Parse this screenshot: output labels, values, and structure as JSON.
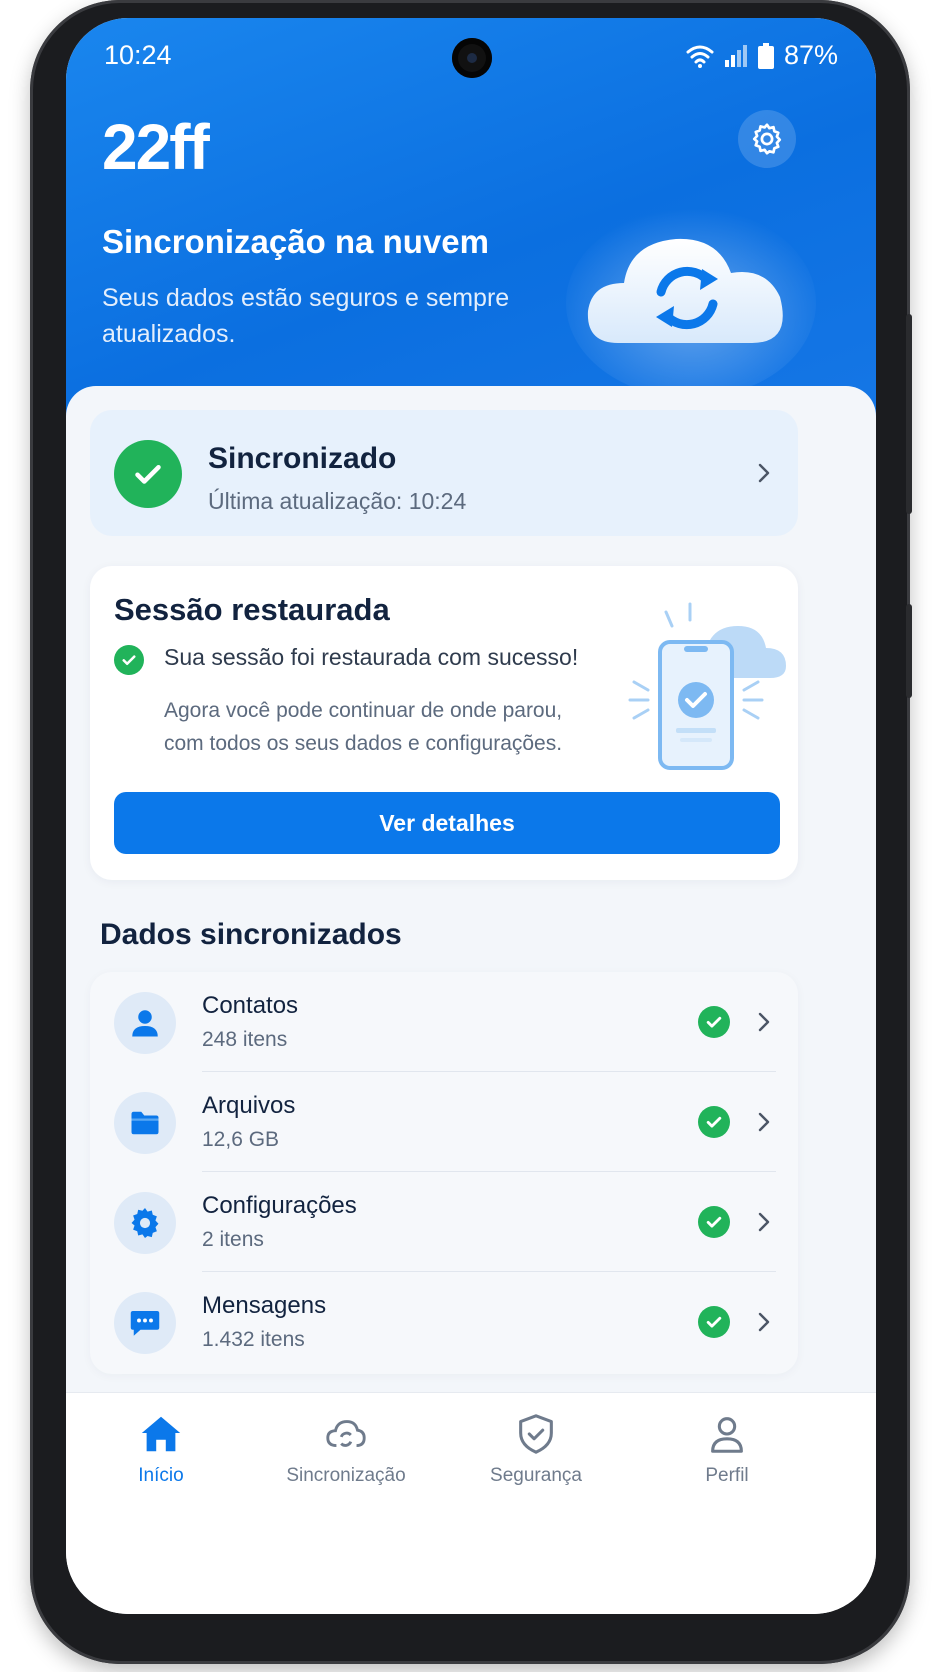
{
  "status_bar": {
    "time": "10:24",
    "battery": "87%"
  },
  "header": {
    "brand": "22ff",
    "title": "Sincronização na nuvem",
    "subtitle": "Seus dados estão seguros e sempre atualizados."
  },
  "sync_status": {
    "title": "Sincronizado",
    "subtitle": "Última atualização: 10:24"
  },
  "session": {
    "title": "Sessão restaurada",
    "success": "Sua sessão foi restaurada com sucesso!",
    "description": "Agora você pode continuar de onde parou, com todos os seus dados e configurações.",
    "button": "Ver detalhes"
  },
  "synced_data": {
    "title": "Dados sincronizados",
    "items": [
      {
        "title": "Contatos",
        "subtitle": "248 itens",
        "icon": "person-icon"
      },
      {
        "title": "Arquivos",
        "subtitle": "12,6 GB",
        "icon": "folder-icon"
      },
      {
        "title": "Configurações",
        "subtitle": "2 itens",
        "icon": "gear-icon"
      },
      {
        "title": "Mensagens",
        "subtitle": "1.432 itens",
        "icon": "chat-icon"
      }
    ]
  },
  "nav": {
    "items": [
      {
        "label": "Início",
        "icon": "home-icon",
        "active": true
      },
      {
        "label": "Sincronização",
        "icon": "cloud-sync-icon",
        "active": false
      },
      {
        "label": "Segurança",
        "icon": "shield-icon",
        "active": false
      },
      {
        "label": "Perfil",
        "icon": "profile-icon",
        "active": false
      }
    ]
  },
  "colors": {
    "primary": "#0b78ea",
    "success": "#21b35a",
    "hero": "#1a86ee",
    "text_dark": "#12233f"
  }
}
